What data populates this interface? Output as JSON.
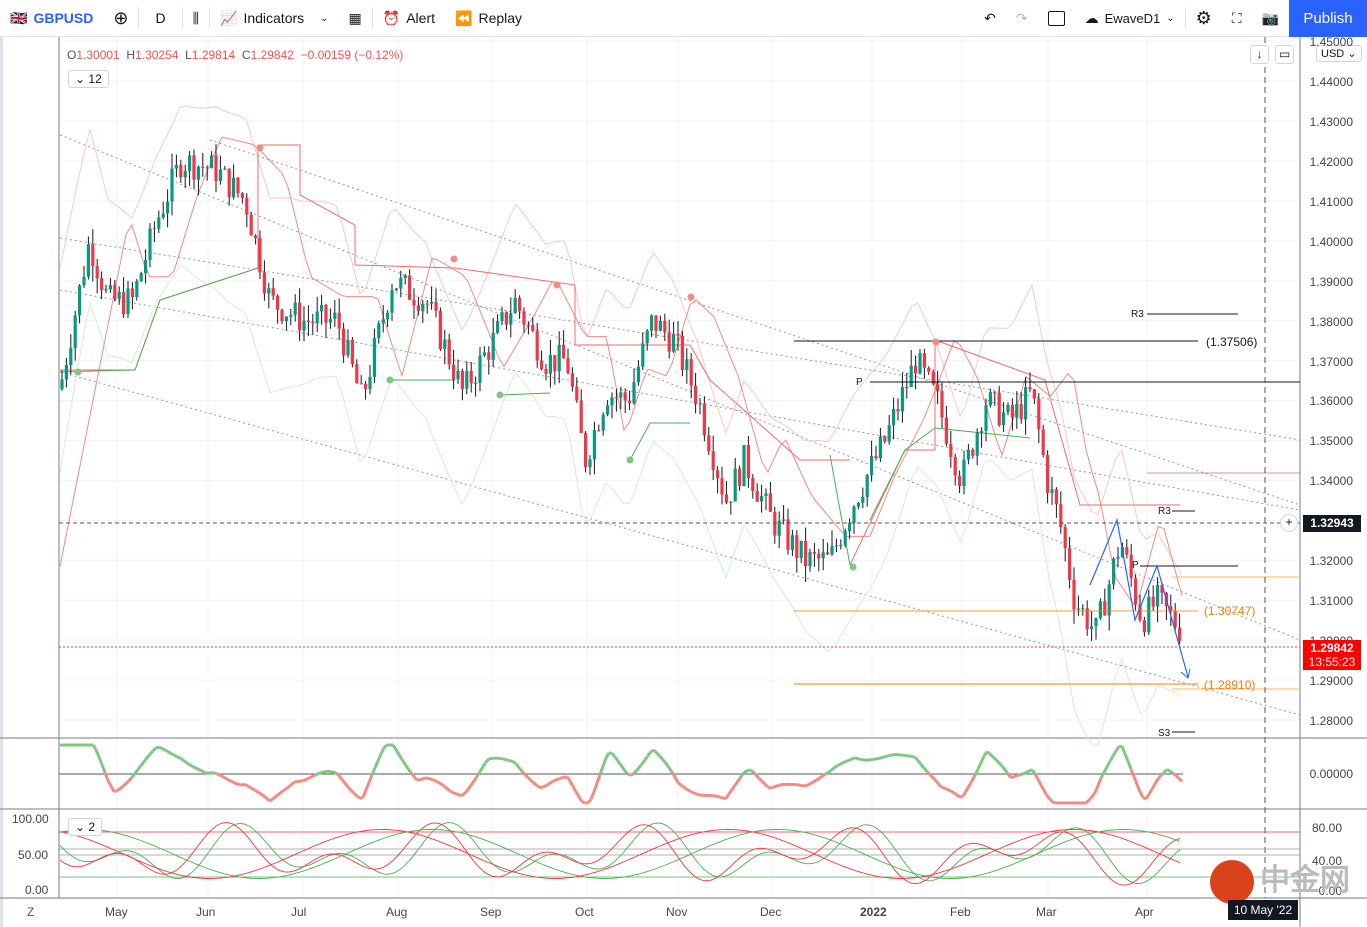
{
  "toolbar": {
    "symbol": "GBPUSD",
    "interval": "D",
    "indicators": "Indicators",
    "alert": "Alert",
    "replay": "Replay",
    "layout": "EwaveD1",
    "publish": "Publish"
  },
  "legend": {
    "o_label": "O",
    "o": "1.30001",
    "h_label": "H",
    "h": "1.30254",
    "l_label": "L",
    "l": "1.29814",
    "c_label": "C",
    "c": "1.29842",
    "change": "−0.00159 (−0.12%)",
    "indicators_count": "12",
    "pane2_count": "2"
  },
  "price_axis": {
    "currency": "USD",
    "labels": [
      "1.45000",
      "1.44000",
      "1.43000",
      "1.42000",
      "1.41000",
      "1.40000",
      "1.39000",
      "1.38000",
      "1.37000",
      "1.36000",
      "1.35000",
      "1.34000",
      "1.33000",
      "1.32000",
      "1.31000",
      "1.30000",
      "1.29000",
      "1.28000"
    ],
    "crosshair_price": "1.32943",
    "last_price": "1.29842",
    "countdown": "13:55:23"
  },
  "osc_axis": {
    "labels": [
      "0.00000"
    ]
  },
  "stoch_axis": {
    "left": [
      "100.00",
      "50.00",
      "0.00"
    ],
    "right": [
      "80.00",
      "40.00",
      "0.00"
    ]
  },
  "time_axis": {
    "labels": [
      "May",
      "Jun",
      "Jul",
      "Aug",
      "Sep",
      "Oct",
      "Nov",
      "Dec",
      "2022",
      "Feb",
      "Mar",
      "Apr"
    ],
    "cursor_date": "10 May '22"
  },
  "annotations": {
    "r3_upper": "R3",
    "p_upper": "P",
    "level1": "(1.37506)",
    "r3_lower": "R3",
    "p_lower": "P",
    "level2": "(1.30747)",
    "level3": "(1.28910)",
    "s3": "S3"
  },
  "colors": {
    "up": "#089981",
    "down": "#f23645",
    "accent": "#2962ff",
    "orange": "#f57c00"
  },
  "chart_data": {
    "type": "candlestick",
    "symbol": "GBPUSD",
    "interval": "D",
    "ylim": [
      1.275,
      1.45
    ],
    "keypoints": [
      [
        "2021-04-15",
        1.373
      ],
      [
        "2021-04-22",
        1.4
      ],
      [
        "2021-04-28",
        1.385
      ],
      [
        "2021-05-06",
        1.385
      ],
      [
        "2021-05-14",
        1.405
      ],
      [
        "2021-05-22",
        1.42
      ],
      [
        "2021-06-02",
        1.418
      ],
      [
        "2021-06-12",
        1.41
      ],
      [
        "2021-06-20",
        1.385
      ],
      [
        "2021-07-01",
        1.38
      ],
      [
        "2021-07-12",
        1.38
      ],
      [
        "2021-07-20",
        1.36
      ],
      [
        "2021-07-30",
        1.39
      ],
      [
        "2021-08-10",
        1.385
      ],
      [
        "2021-08-18",
        1.37
      ],
      [
        "2021-08-22",
        1.362
      ],
      [
        "2021-09-01",
        1.375
      ],
      [
        "2021-09-08",
        1.385
      ],
      [
        "2021-09-18",
        1.37
      ],
      [
        "2021-09-25",
        1.37
      ],
      [
        "2021-10-01",
        1.345
      ],
      [
        "2021-10-08",
        1.362
      ],
      [
        "2021-10-15",
        1.36
      ],
      [
        "2021-10-23",
        1.38
      ],
      [
        "2021-10-30",
        1.375
      ],
      [
        "2021-11-07",
        1.36
      ],
      [
        "2021-11-16",
        1.335
      ],
      [
        "2021-11-22",
        1.345
      ],
      [
        "2021-12-01",
        1.33
      ],
      [
        "2021-12-12",
        1.32
      ],
      [
        "2021-12-20",
        1.32
      ],
      [
        "2021-12-28",
        1.335
      ],
      [
        "2022-01-07",
        1.35
      ],
      [
        "2022-01-17",
        1.37
      ],
      [
        "2022-01-24",
        1.36
      ],
      [
        "2022-02-01",
        1.34
      ],
      [
        "2022-02-09",
        1.36
      ],
      [
        "2022-02-17",
        1.355
      ],
      [
        "2022-02-24",
        1.362
      ],
      [
        "2022-03-01",
        1.34
      ],
      [
        "2022-03-05",
        1.33
      ],
      [
        "2022-03-10",
        1.31
      ],
      [
        "2022-03-17",
        1.302
      ],
      [
        "2022-03-25",
        1.325
      ],
      [
        "2022-04-01",
        1.305
      ],
      [
        "2022-04-06",
        1.31
      ],
      [
        "2022-04-18",
        1.2984
      ]
    ]
  }
}
